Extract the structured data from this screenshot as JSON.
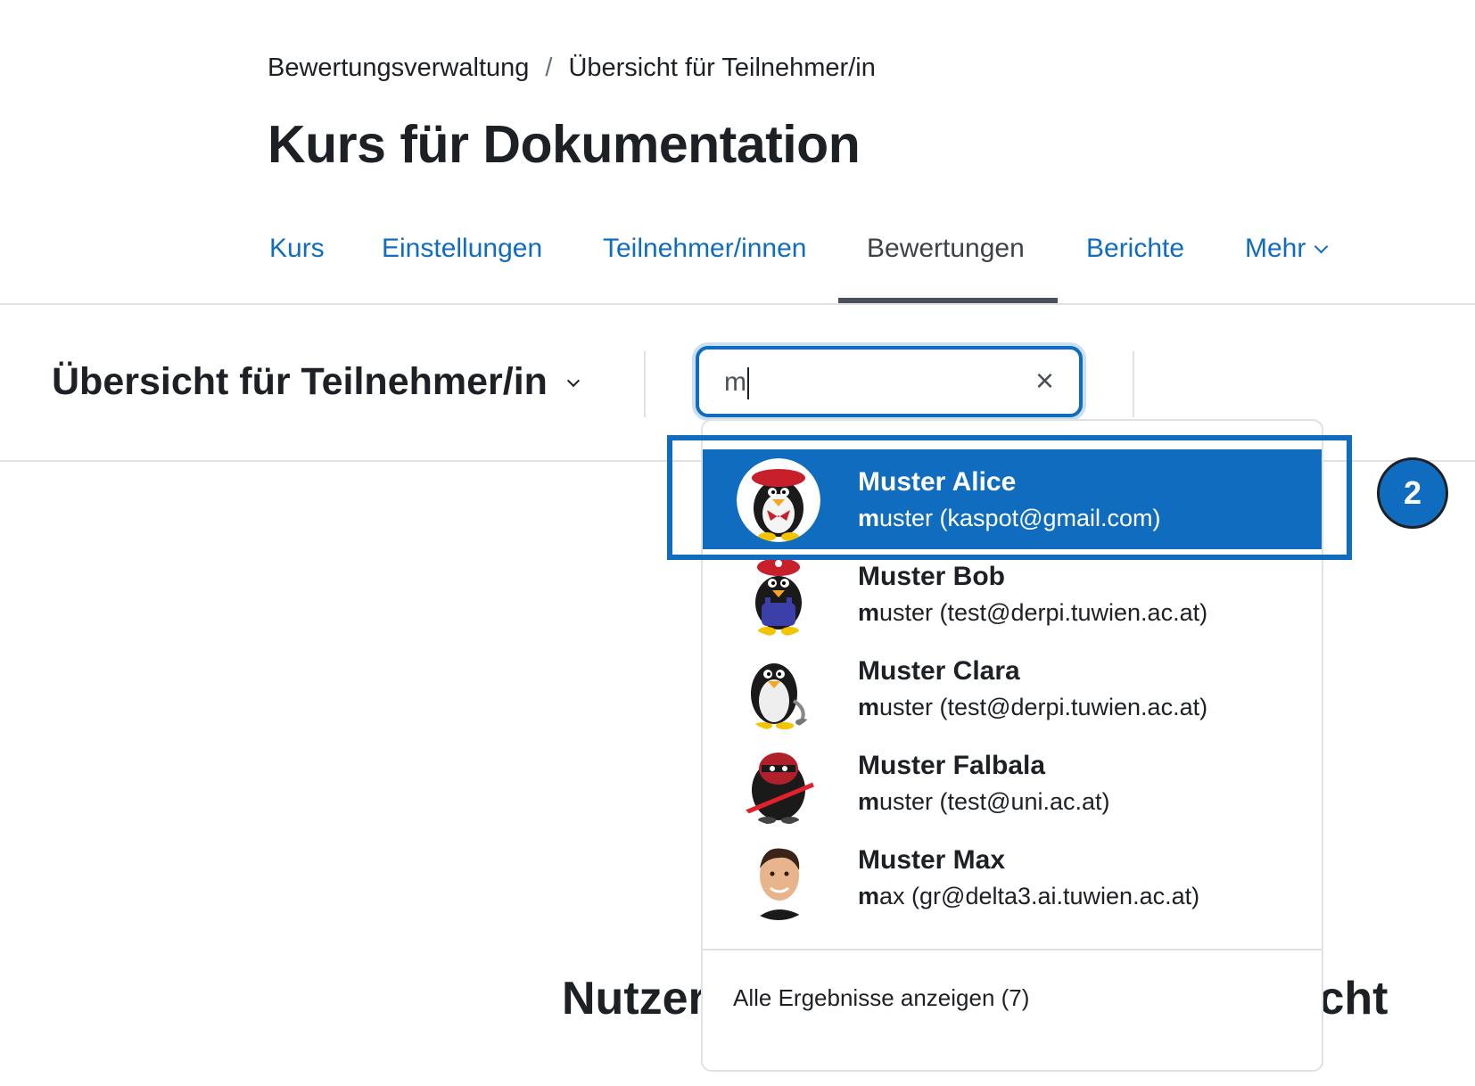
{
  "breadcrumb": {
    "items": [
      "Bewertungsverwaltung",
      "Übersicht für Teilnehmer/in"
    ],
    "separator": "/"
  },
  "page_title": "Kurs für Dokumentation",
  "nav": {
    "tabs": [
      {
        "label": "Kurs",
        "active": false
      },
      {
        "label": "Einstellungen",
        "active": false
      },
      {
        "label": "Teilnehmer/innen",
        "active": false
      },
      {
        "label": "Bewertungen",
        "active": true
      },
      {
        "label": "Berichte",
        "active": false
      },
      {
        "label": "Mehr",
        "active": false,
        "dropdown": true
      }
    ]
  },
  "report_selector": {
    "label": "Übersicht für Teilnehmer/in"
  },
  "search": {
    "value": "m",
    "clear_icon": "×"
  },
  "results": [
    {
      "name": "Muster Alice",
      "match": "m",
      "rest": "uster (kaspot@gmail.com)",
      "selected": true,
      "avatar": "penguin-beret-avatar"
    },
    {
      "name": "Muster Bob",
      "match": "m",
      "rest": "uster (test@derpi.tuwien.ac.at)",
      "selected": false,
      "avatar": "penguin-plumber-avatar"
    },
    {
      "name": "Muster Clara",
      "match": "m",
      "rest": "uster (test@derpi.tuwien.ac.at)",
      "selected": false,
      "avatar": "penguin-classic-avatar"
    },
    {
      "name": "Muster Falbala",
      "match": "m",
      "rest": "uster (test@uni.ac.at)",
      "selected": false,
      "avatar": "penguin-ninja-avatar"
    },
    {
      "name": "Muster Max",
      "match": "m",
      "rest": "ax (gr@delta3.ai.tuwien.ac.at)",
      "selected": false,
      "avatar": "person-photo-avatar"
    }
  ],
  "show_all": "Alle Ergebnisse anzeigen (7)",
  "background_heading": {
    "left": "Nutzer",
    "right": "icht"
  },
  "step_badge": "2",
  "colors": {
    "accent": "#0f6cbf",
    "text": "#1d2125",
    "divider": "#dee2e6"
  }
}
